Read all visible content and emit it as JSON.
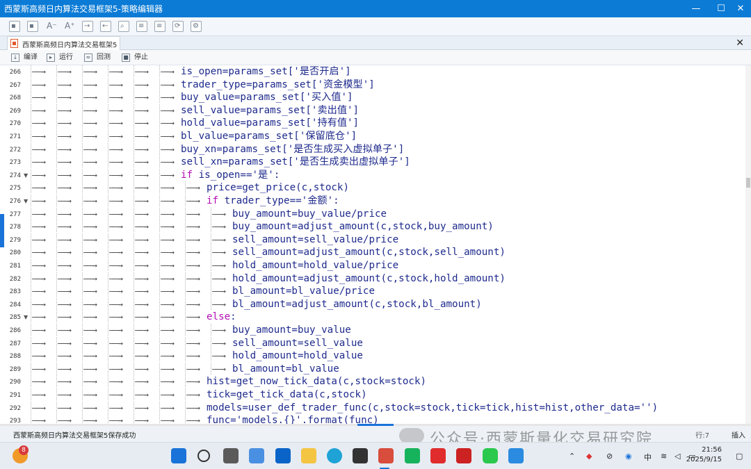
{
  "window": {
    "title": "西蒙斯高频日内算法交易框架5-策略编辑器",
    "minimize": "—",
    "maximize": "☐",
    "close": "✕"
  },
  "tab": {
    "label": "西蒙斯高频日内算法交易框架5",
    "close": "✕"
  },
  "actions": [
    {
      "label": "编译",
      "icon": "compile-icon"
    },
    {
      "label": "运行",
      "icon": "run-icon"
    },
    {
      "label": "回测",
      "icon": "backtest-icon"
    },
    {
      "label": "停止",
      "icon": "stop-icon"
    }
  ],
  "code_lines": [
    {
      "n": "266",
      "depth": 6,
      "fold": "",
      "text": "is_open=params_set['是否开启']"
    },
    {
      "n": "267",
      "depth": 6,
      "fold": "",
      "text": "trader_type=params_set['资金模型']"
    },
    {
      "n": "268",
      "depth": 6,
      "fold": "",
      "text": "buy_value=params_set['买入值']"
    },
    {
      "n": "269",
      "depth": 6,
      "fold": "",
      "text": "sell_value=params_set['卖出值']"
    },
    {
      "n": "270",
      "depth": 6,
      "fold": "",
      "text": "hold_value=params_set['持有值']"
    },
    {
      "n": "271",
      "depth": 6,
      "fold": "",
      "text": "bl_value=params_set['保留底仓']"
    },
    {
      "n": "272",
      "depth": 6,
      "fold": "",
      "text": "buy_xn=params_set['是否生成买入虚拟单子']"
    },
    {
      "n": "273",
      "depth": 6,
      "fold": "",
      "text": "sell_xn=params_set['是否生成卖出虚拟单子']"
    },
    {
      "n": "274",
      "depth": 6,
      "fold": "▼",
      "kw": "if",
      "text": " is_open=='是':"
    },
    {
      "n": "275",
      "depth": 7,
      "fold": "",
      "text": "price=get_price(c,stock)"
    },
    {
      "n": "276",
      "depth": 7,
      "fold": "▼",
      "kw": "if",
      "text": " trader_type=='金额':"
    },
    {
      "n": "277",
      "depth": 8,
      "fold": "",
      "text": "buy_amount=buy_value/price"
    },
    {
      "n": "278",
      "depth": 8,
      "fold": "",
      "text": "buy_amount=adjust_amount(c,stock,buy_amount)"
    },
    {
      "n": "279",
      "depth": 8,
      "fold": "",
      "text": "sell_amount=sell_value/price"
    },
    {
      "n": "280",
      "depth": 8,
      "fold": "",
      "text": "sell_amount=adjust_amount(c,stock,sell_amount)"
    },
    {
      "n": "281",
      "depth": 8,
      "fold": "",
      "text": "hold_amount=hold_value/price"
    },
    {
      "n": "282",
      "depth": 8,
      "fold": "",
      "text": "hold_amount=adjust_amount(c,stock,hold_amount)"
    },
    {
      "n": "283",
      "depth": 8,
      "fold": "",
      "text": "bl_amount=bl_value/price"
    },
    {
      "n": "284",
      "depth": 8,
      "fold": "",
      "text": "bl_amount=adjust_amount(c,stock,bl_amount)"
    },
    {
      "n": "285",
      "depth": 7,
      "fold": "▼",
      "kw": "else",
      "text": ":"
    },
    {
      "n": "286",
      "depth": 8,
      "fold": "",
      "text": "buy_amount=buy_value"
    },
    {
      "n": "287",
      "depth": 8,
      "fold": "",
      "text": "sell_amount=sell_value"
    },
    {
      "n": "288",
      "depth": 8,
      "fold": "",
      "text": "hold_amount=hold_value"
    },
    {
      "n": "289",
      "depth": 8,
      "fold": "",
      "text": "bl_amount=bl_value"
    },
    {
      "n": "290",
      "depth": 7,
      "fold": "",
      "text": "hist=get_now_tick_data(c,stock=stock)"
    },
    {
      "n": "291",
      "depth": 7,
      "fold": "",
      "text": "tick=get_tick_data(c,stock)"
    },
    {
      "n": "292",
      "depth": 7,
      "fold": "",
      "text": "models=user_def_trader_func(c,stock=stock,tick=tick,hist=hist,other_data='')"
    },
    {
      "n": "293",
      "depth": 7,
      "fold": "",
      "text": "func='models.{}'.format(func)"
    }
  ],
  "status": {
    "message": "西蒙斯高频日内算法交易框架5保存成功",
    "mode": "插入",
    "position": "行:7"
  },
  "watermark": "公众号·西蒙斯量化交易研究院",
  "taskbar": {
    "widget_badge": "8",
    "ime": "中",
    "time": "21:56",
    "date": "2025/9/15"
  },
  "colors": {
    "titlebar": "#0b7bd6",
    "code_text": "#1e2a8c",
    "keyword": "#b40fb4"
  }
}
